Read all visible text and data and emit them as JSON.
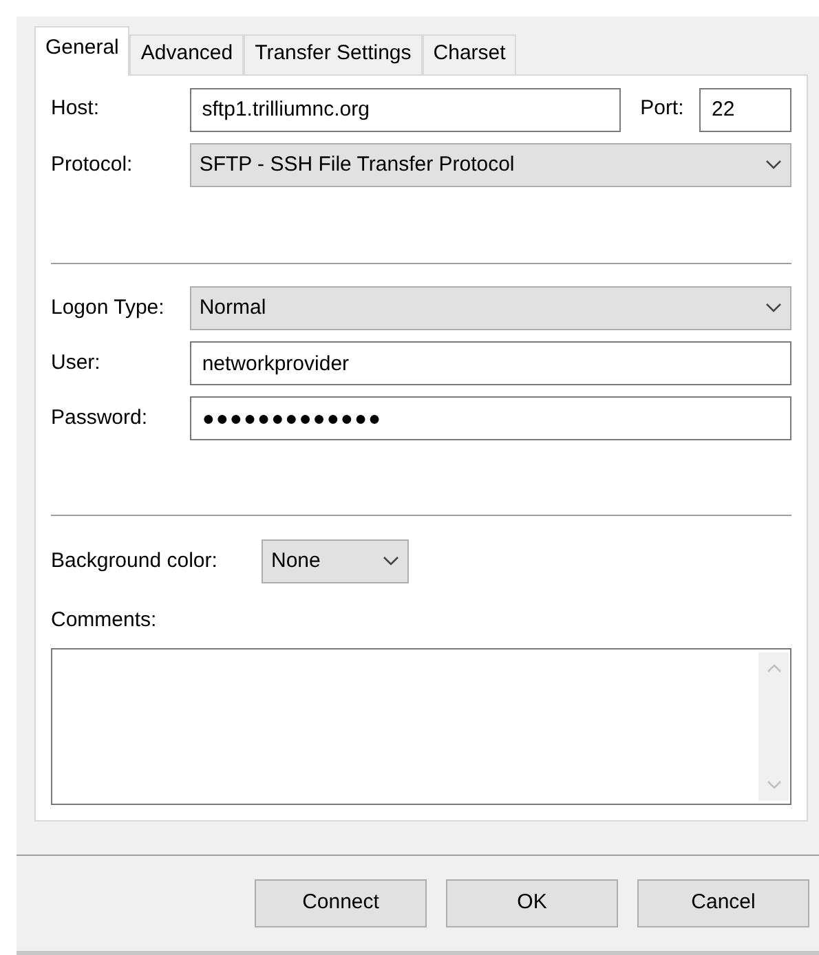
{
  "tabs": [
    {
      "label": "General",
      "selected": true
    },
    {
      "label": "Advanced",
      "selected": false
    },
    {
      "label": "Transfer Settings",
      "selected": false
    },
    {
      "label": "Charset",
      "selected": false
    }
  ],
  "host": {
    "label": "Host:",
    "value": "sftp1.trilliumnc.org"
  },
  "port": {
    "label": "Port:",
    "value": "22"
  },
  "protocol": {
    "label": "Protocol:",
    "value": "SFTP - SSH File Transfer Protocol"
  },
  "logon_type": {
    "label": "Logon Type:",
    "value": "Normal"
  },
  "user": {
    "label": "User:",
    "value": "networkprovider"
  },
  "password": {
    "label": "Password:",
    "value": "●●●●●●●●●●●●●"
  },
  "background_color": {
    "label": "Background color:",
    "value": "None"
  },
  "comments": {
    "label": "Comments:"
  },
  "buttons": [
    {
      "label": "Connect"
    },
    {
      "label": "OK"
    },
    {
      "label": "Cancel"
    }
  ]
}
